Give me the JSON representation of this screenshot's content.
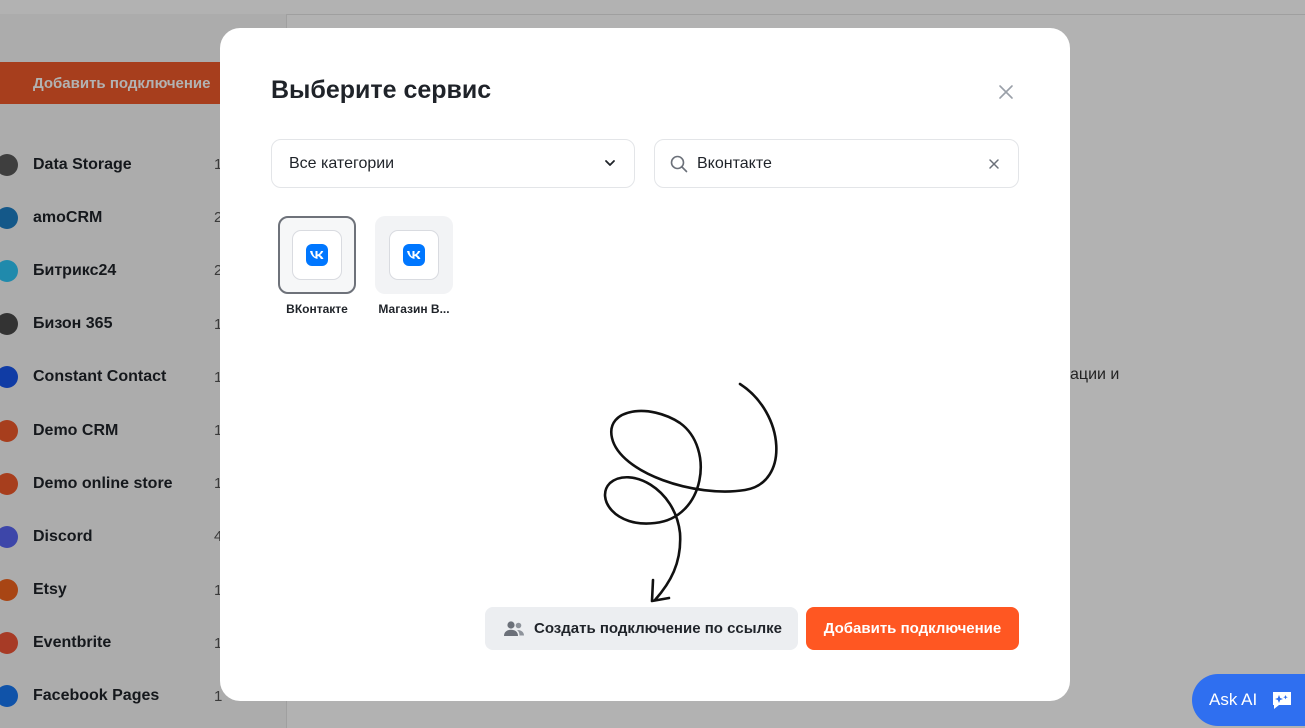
{
  "background": {
    "sidebar_add_button": "Добавить подключение",
    "sidebar_items": [
      {
        "label": "Data Storage",
        "count": "1",
        "icon": "data-storage-icon",
        "color": "#5a5a5a"
      },
      {
        "label": "amoCRM",
        "count": "2",
        "icon": "amocrm-icon",
        "color": "#1d7fc4"
      },
      {
        "label": "Битрикс24",
        "count": "2",
        "icon": "bitrix24-icon",
        "color": "#2fc6f6"
      },
      {
        "label": "Бизон 365",
        "count": "1",
        "icon": "bizon365-icon",
        "color": "#4a4a4a"
      },
      {
        "label": "Constant Contact",
        "count": "1",
        "icon": "constant-contact-icon",
        "color": "#1856ed"
      },
      {
        "label": "Demo CRM",
        "count": "1",
        "icon": "demo-crm-icon",
        "color": "#f05a2a"
      },
      {
        "label": "Demo online store",
        "count": "1",
        "icon": "demo-store-icon",
        "color": "#f05a2a"
      },
      {
        "label": "Discord",
        "count": "4",
        "icon": "discord-icon",
        "color": "#5865f2"
      },
      {
        "label": "Etsy",
        "count": "1",
        "icon": "etsy-icon",
        "color": "#f1641e"
      },
      {
        "label": "Eventbrite",
        "count": "1",
        "icon": "eventbrite-icon",
        "color": "#f05537"
      },
      {
        "label": "Facebook Pages",
        "count": "1",
        "icon": "facebook-icon",
        "color": "#1877f2"
      }
    ],
    "partial_text": "ации и"
  },
  "modal": {
    "title": "Выберите сервис",
    "category_select": {
      "value": "Все категории"
    },
    "search": {
      "value": "Вконтакте"
    },
    "services": [
      {
        "label": "ВКонтакте",
        "selected": true
      },
      {
        "label": "Магазин В..."
      }
    ],
    "link_button_label": "Создать подключение по ссылке",
    "add_button_label": "Добавить подключение"
  },
  "ask_ai": {
    "label": "Ask AI"
  },
  "colors": {
    "accent": "#ff5722",
    "vk_blue": "#0077ff",
    "ask_ai_blue": "#2f6ff0"
  }
}
